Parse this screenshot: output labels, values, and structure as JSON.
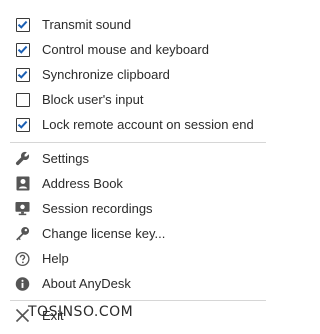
{
  "toggles": [
    {
      "label": "Transmit sound",
      "checked": true
    },
    {
      "label": "Control mouse and keyboard",
      "checked": true
    },
    {
      "label": "Synchronize clipboard",
      "checked": true
    },
    {
      "label": "Block user's input",
      "checked": false
    },
    {
      "label": "Lock remote account on session end",
      "checked": true
    }
  ],
  "actions": [
    {
      "label": "Settings",
      "icon": "wrench-icon"
    },
    {
      "label": "Address Book",
      "icon": "address-book-icon"
    },
    {
      "label": "Session recordings",
      "icon": "monitor-recording-icon"
    },
    {
      "label": "Change license key...",
      "icon": "key-icon"
    },
    {
      "label": "Help",
      "icon": "help-circle-icon"
    },
    {
      "label": "About AnyDesk",
      "icon": "info-circle-icon"
    }
  ],
  "exit": {
    "label": "Exit",
    "icon": "close-icon"
  },
  "watermark": "TOSINSO.COM",
  "colors": {
    "check": "#1a5fb4",
    "text": "#2b2b2b",
    "icon": "#555555",
    "separator": "#d6d6d6"
  }
}
